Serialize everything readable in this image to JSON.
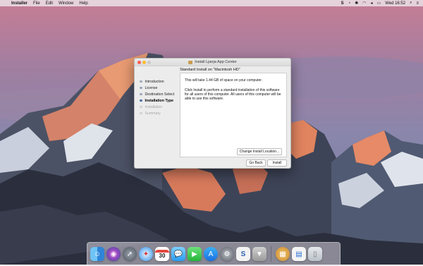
{
  "menubar": {
    "apple": "",
    "app_name": "Installer",
    "menus": [
      "File",
      "Edit",
      "Window",
      "Help"
    ],
    "status_letter": "S",
    "clock": "Wed 16:52"
  },
  "window": {
    "title": "Install Ljanja App Center",
    "header": "Standard Install on “Macintosh HD”",
    "steps": [
      {
        "label": "Introduction",
        "state": "done"
      },
      {
        "label": "License",
        "state": "done"
      },
      {
        "label": "Destination Select",
        "state": "done"
      },
      {
        "label": "Installation Type",
        "state": "current"
      },
      {
        "label": "Installation",
        "state": "pending"
      },
      {
        "label": "Summary",
        "state": "pending"
      }
    ],
    "body_text_1": "This will take 1.44 GB of space on your computer.",
    "body_text_2": "Click Install to perform a standard installation of this software for all users of this computer. All users of this computer will be able to use this software.",
    "change_location_label": "Change Install Location...",
    "back_label": "Go Back",
    "install_label": "Install"
  },
  "dock": {
    "icons": [
      "finder-icon",
      "siri-icon",
      "launchpad-icon",
      "safari-icon",
      "calendar-icon",
      "messages-icon",
      "facetime-icon",
      "app-store-icon",
      "system-preferences-icon",
      "scrivener-icon",
      "installer-icon",
      "archive-icon",
      "preview-icon",
      "trash-icon"
    ],
    "calendar_day": "30"
  }
}
